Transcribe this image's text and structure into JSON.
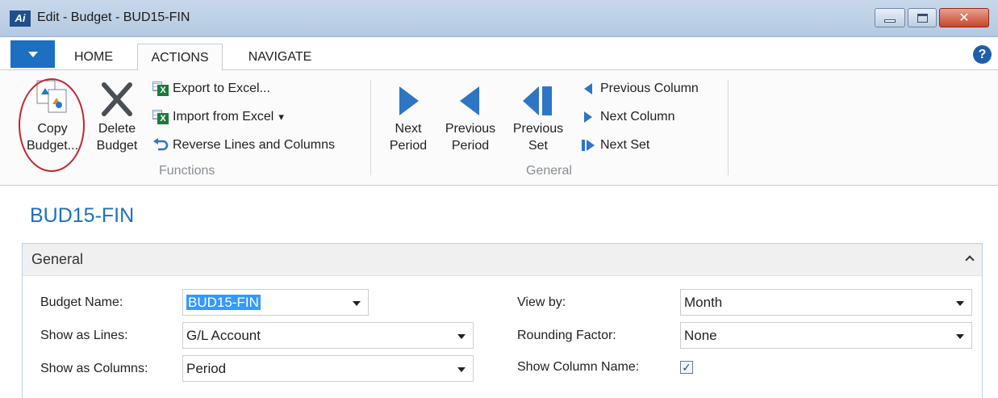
{
  "window": {
    "title": "Edit - Budget - BUD15-FIN",
    "logo_text": "Ai",
    "close_glyph": "✕"
  },
  "ribbon": {
    "tabs": [
      {
        "label": "HOME"
      },
      {
        "label": "ACTIONS",
        "active": true
      },
      {
        "label": "NAVIGATE"
      }
    ],
    "help_glyph": "?",
    "groups": {
      "functions": {
        "label": "Functions",
        "copy_budget": [
          "Copy",
          "Budget..."
        ],
        "delete_budget": [
          "Delete",
          "Budget"
        ],
        "export_excel": "Export to Excel...",
        "import_excel": "Import from Excel",
        "import_caret": "▾",
        "reverse": "Reverse Lines and Columns"
      },
      "general": {
        "label": "General",
        "next_period": [
          "Next",
          "Period"
        ],
        "previous_period": [
          "Previous",
          "Period"
        ],
        "previous_set": [
          "Previous",
          "Set"
        ],
        "previous_column": "Previous Column",
        "next_column": "Next Column",
        "next_set": "Next Set"
      }
    }
  },
  "page": {
    "title": "BUD15-FIN"
  },
  "general_tab": {
    "title": "General",
    "fields": {
      "budget_name": {
        "label": "Budget Name:",
        "value": "BUD15-FIN"
      },
      "show_as_lines": {
        "label": "Show as Lines:",
        "value": "G/L Account"
      },
      "show_as_columns": {
        "label": "Show as Columns:",
        "value": "Period"
      },
      "view_by": {
        "label": "View by:",
        "value": "Month"
      },
      "rounding_factor": {
        "label": "Rounding Factor:",
        "value": "None"
      },
      "show_column_name": {
        "label": "Show Column Name:",
        "checked": true,
        "check_glyph": "✓"
      }
    }
  },
  "colors": {
    "accent": "#1f6fc0",
    "arrow": "#2e75c4",
    "highlight_circle": "#c4262e"
  }
}
